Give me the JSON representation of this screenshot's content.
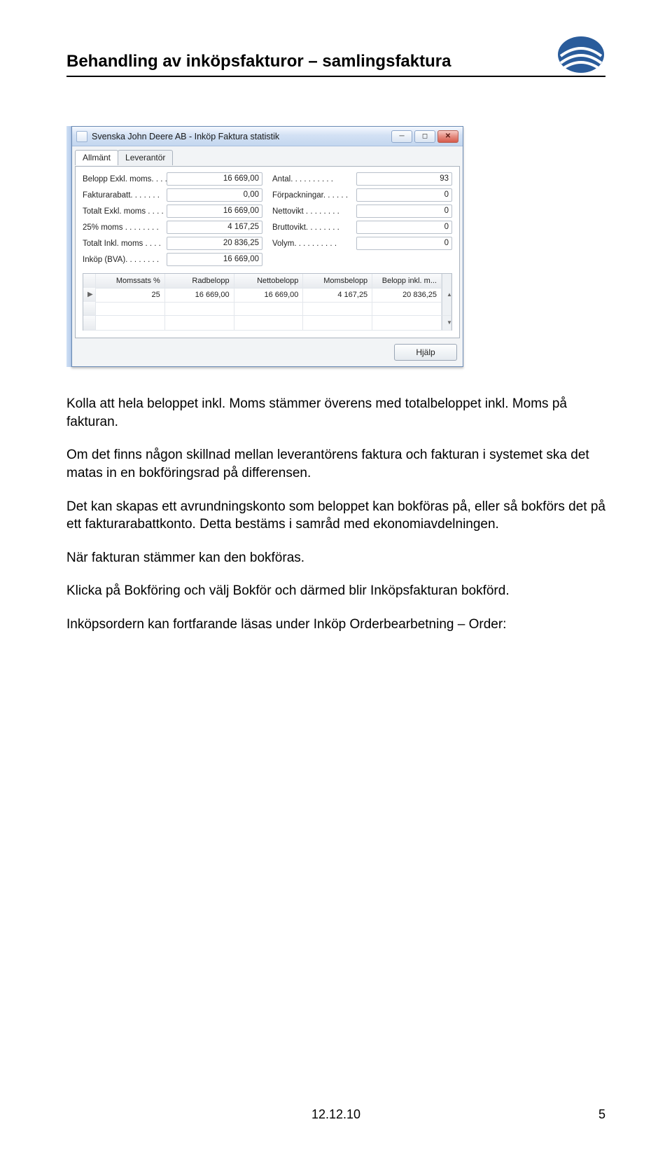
{
  "header": {
    "title": "Behandling av inköpsfakturor – samlingsfaktura"
  },
  "window": {
    "title": "Svenska John Deere AB - Inköp Faktura statistik",
    "tabs": {
      "general": "Allmänt",
      "supplier": "Leverantör"
    },
    "stats_left": [
      {
        "label": "Belopp Exkl. moms. . . .",
        "value": "16 669,00"
      },
      {
        "label": "Fakturarabatt. . . . . . .",
        "value": "0,00"
      },
      {
        "label": "Totalt Exkl. moms . . . .",
        "value": "16 669,00"
      },
      {
        "label": "25% moms . . . . . . . .",
        "value": "4 167,25"
      },
      {
        "label": "Totalt Inkl. moms . . . .",
        "value": "20 836,25"
      },
      {
        "label": "Inköp (BVA). . . . . . . .",
        "value": "16 669,00"
      }
    ],
    "stats_right": [
      {
        "label": "Antal. . . . . . . . . .",
        "value": "93"
      },
      {
        "label": "Förpackningar. . . . . .",
        "value": "0"
      },
      {
        "label": "Nettovikt . . . . . . . .",
        "value": "0"
      },
      {
        "label": "Bruttovikt. . . . . . . .",
        "value": "0"
      },
      {
        "label": "Volym. . . . . . . . . .",
        "value": "0"
      }
    ],
    "table": {
      "headers": [
        "Momssats %",
        "Radbelopp",
        "Nettobelopp",
        "Momsbelopp",
        "Belopp inkl. m..."
      ],
      "row": [
        "25",
        "16 669,00",
        "16 669,00",
        "4 167,25",
        "20 836,25"
      ]
    },
    "help_label": "Hjälp"
  },
  "paragraphs": {
    "p1": "Kolla att hela beloppet inkl. Moms stämmer överens med totalbeloppet inkl. Moms på fakturan.",
    "p2": "Om det finns någon skillnad mellan leverantörens faktura och fakturan i systemet ska det matas in en bokföringsrad på differensen.",
    "p3": "Det kan skapas ett avrundningskonto som beloppet kan bokföras på, eller så bokförs det på ett fakturarabattkonto. Detta bestäms i samråd med ekonomiavdelningen.",
    "p4": "När fakturan stämmer kan den bokföras.",
    "p5": "Klicka på Bokföring och välj Bokför och därmed blir Inköpsfakturan bokförd.",
    "p6": "Inköpsordern kan fortfarande läsas under Inköp Orderbearbetning – Order:"
  },
  "footer": {
    "date": "12.12.10",
    "page": "5"
  }
}
